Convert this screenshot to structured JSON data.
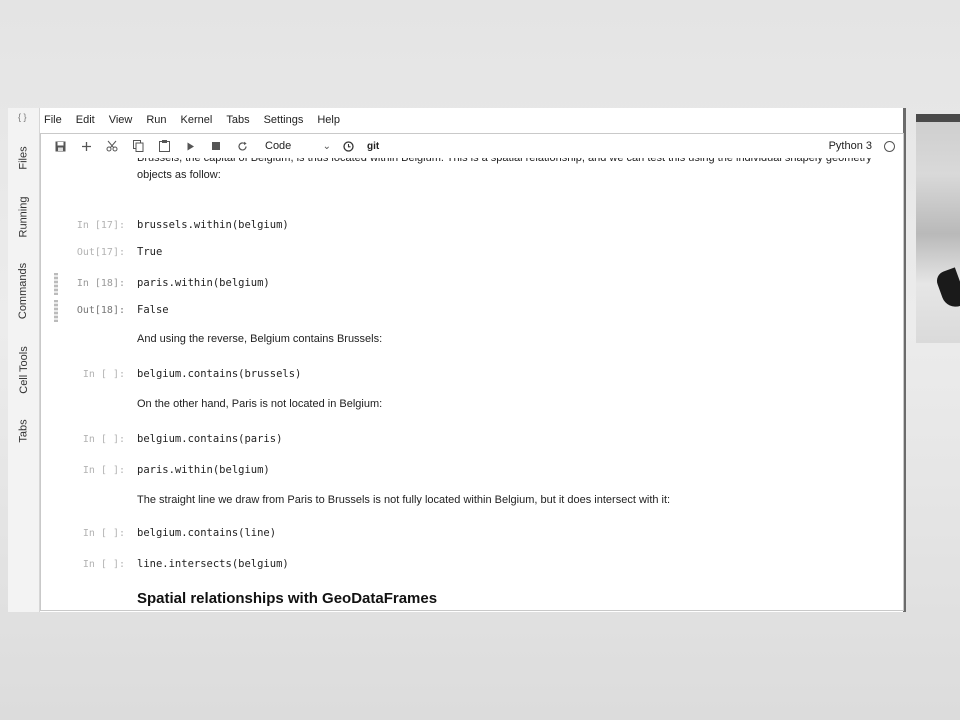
{
  "left_rail": {
    "top_glyph": "{ }",
    "tabs": [
      "Files",
      "Running",
      "Commands",
      "Cell Tools",
      "Tabs"
    ]
  },
  "menubar": [
    "File",
    "Edit",
    "View",
    "Run",
    "Kernel",
    "Tabs",
    "Settings",
    "Help"
  ],
  "toolbar": {
    "icons": [
      "save-icon",
      "add-cell-icon",
      "cut-icon",
      "copy-icon",
      "paste-icon",
      "run-icon",
      "stop-icon",
      "restart-icon"
    ],
    "cell_type": "Code",
    "git_label": "git",
    "kernel": "Python 3"
  },
  "cells": {
    "md1": "Brussels, the capital of Belgium, is thus located within Belgium. This is a spatial relationship, and we can test this using the individual shapely geometry objects as follow:",
    "c17_prompt": "In [17]:",
    "c17_code": "brussels.within(belgium)",
    "c17_out_prompt": "Out[17]:",
    "c17_out": "True",
    "c18_prompt": "In [18]:",
    "c18_code": "paris.within(belgium)",
    "c18_out_prompt": "Out[18]:",
    "c18_out": "False",
    "md2": "And using the reverse, Belgium contains Brussels:",
    "c3_prompt": "In [ ]:",
    "c3_code": "belgium.contains(brussels)",
    "md3": "On the other hand, Paris is not located in Belgium:",
    "c4_prompt": "In [ ]:",
    "c4_code": "belgium.contains(paris)",
    "c5_prompt": "In [ ]:",
    "c5_code": "paris.within(belgium)",
    "md4": "The straight line we draw from Paris to Brussels is not fully located within Belgium, but it does intersect with it:",
    "c6_prompt": "In [ ]:",
    "c6_code": "belgium.contains(line)",
    "c7_prompt": "In [ ]:",
    "c7_code": "line.intersects(belgium)",
    "heading": "Spatial relationships with GeoDataFrames"
  }
}
